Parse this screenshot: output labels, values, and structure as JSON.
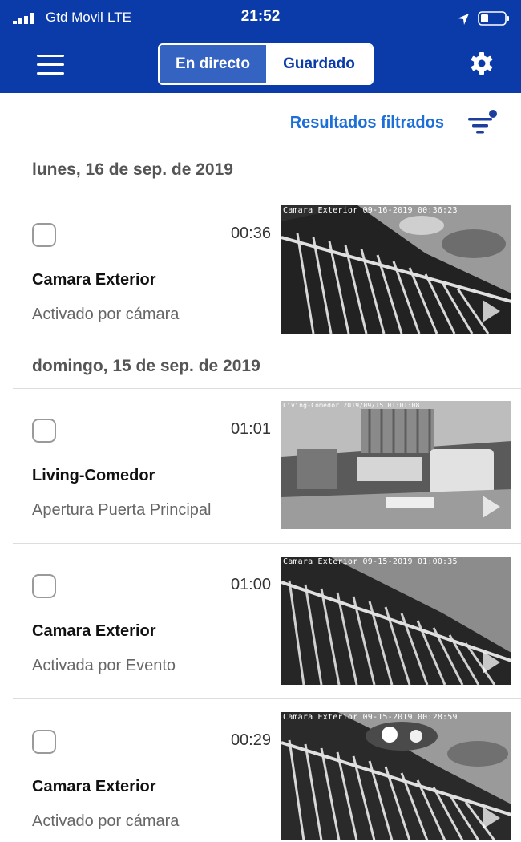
{
  "status_bar": {
    "carrier": "Gtd Movil",
    "network": "LTE",
    "time": "21:52"
  },
  "nav": {
    "tabs": [
      {
        "label": "En directo",
        "selected": false
      },
      {
        "label": "Guardado",
        "selected": true
      }
    ],
    "menu_icon": "hamburger-icon",
    "settings_icon": "gear-icon"
  },
  "filter": {
    "label": "Resultados filtrados",
    "icon": "filter-icon"
  },
  "colors": {
    "header_blue": "#0a3ba8",
    "active_tab": "#3563c1",
    "link_blue": "#1c6ed8"
  },
  "sections": [
    {
      "date": "lunes, 16 de sep. de 2019",
      "events": [
        {
          "time": "00:36",
          "camera": "Camara Exterior",
          "trigger": "Activado por cámara",
          "overlay": "Camara Exterior 09-16-2019 00:36:23"
        }
      ]
    },
    {
      "date": "domingo, 15 de sep. de 2019",
      "events": [
        {
          "time": "01:01",
          "camera": "Living-Comedor",
          "trigger": "Apertura Puerta Principal",
          "overlay": "Living-Comedor 2019/09/15 01:01:08"
        },
        {
          "time": "01:00",
          "camera": "Camara Exterior",
          "trigger": "Activada por Evento",
          "overlay": "Camara Exterior 09-15-2019 01:00:35"
        },
        {
          "time": "00:29",
          "camera": "Camara Exterior",
          "trigger": "Activado por cámara",
          "overlay": "Camara Exterior 09-15-2019 00:28:59"
        }
      ]
    }
  ]
}
